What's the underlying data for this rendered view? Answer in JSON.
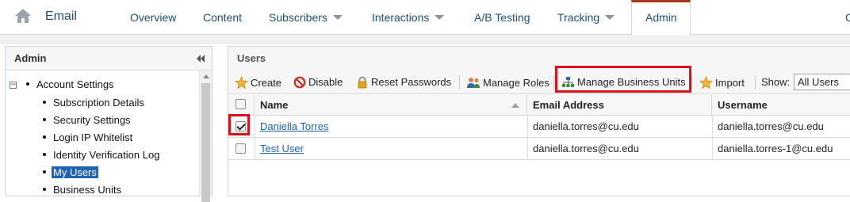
{
  "nav": {
    "app_title": "Email",
    "items": [
      {
        "label": "Overview",
        "caret": false
      },
      {
        "label": "Content",
        "caret": false
      },
      {
        "label": "Subscribers",
        "caret": true
      },
      {
        "label": "Interactions",
        "caret": true
      },
      {
        "label": "A/B Testing",
        "caret": false
      },
      {
        "label": "Tracking",
        "caret": true
      }
    ],
    "active": "Admin",
    "right_stub": "C"
  },
  "left_panel": {
    "title": "Admin",
    "tree": {
      "expander": "−",
      "root": "Account Settings",
      "children": [
        "Subscription Details",
        "Security Settings",
        "Login IP Whitelist",
        "Identity Verification Log",
        "My Users",
        "Business Units"
      ],
      "selected_index": 4
    }
  },
  "users_panel": {
    "title": "Users",
    "toolbar": {
      "create": "Create",
      "disable": "Disable",
      "reset_passwords": "Reset Passwords",
      "manage_roles": "Manage Roles",
      "manage_business_units": "Manage Business Units",
      "import": "Import",
      "show_label": "Show:",
      "show_value": "All Users"
    },
    "columns": [
      "Name",
      "Email Address",
      "Username"
    ],
    "rows": [
      {
        "checked": true,
        "name": "Daniella Torres",
        "email": "daniella.torres@cu.edu",
        "username": "daniella.torres@cu.edu"
      },
      {
        "checked": false,
        "name": "Test User",
        "email": "daniella.torres@cu.edu",
        "username": "daniella.torres-1@cu.edu"
      }
    ]
  },
  "colors": {
    "nav_text": "#1d4f77",
    "active_tab_accent": "#a4381c",
    "selection": "#1e63b4",
    "highlight_box": "#d9121b"
  }
}
